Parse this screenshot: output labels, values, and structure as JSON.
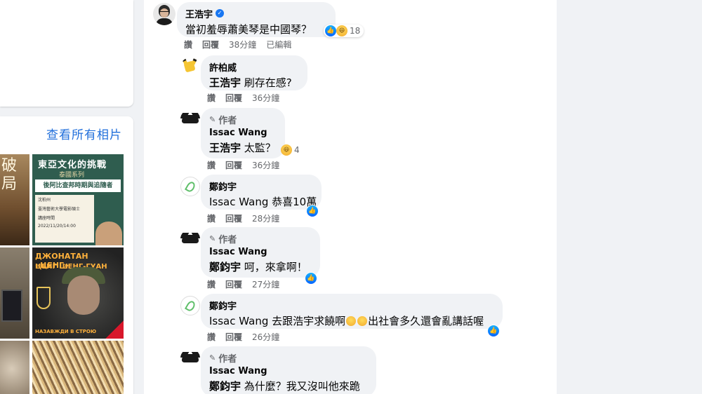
{
  "left_panel": {
    "photos_link": "查看所有相片",
    "thumb1_text": "破\n局",
    "thumb2": {
      "title": "東亞文化的挑戰",
      "subtitle": "泰國系列",
      "band": "後阿比查邦時期與追隨者",
      "lines": [
        "沈柏州",
        "臺灣藝術大學電影碩士",
        "講座時間",
        "2022/11/20/14:00"
      ]
    },
    "thumb4": {
      "line1": "ДЖОНАТАН «ЦЕНГ»",
      "line2": "ЦЕНГ ШЕНГ-ГУАН",
      "bottom": "НАЗАВЖДИ В СТРОЮ"
    }
  },
  "comments": [
    {
      "author": "王浩宇",
      "verified": true,
      "text": "當初羞辱蕭美琴是中國琴？",
      "reactions": [
        "like",
        "haha"
      ],
      "reaction_count": "18",
      "actions": [
        "讚",
        "回覆"
      ],
      "time": "38分鐘",
      "edited": "已編輯"
    },
    {
      "author": "許柏威",
      "mention": "王浩宇",
      "text": "刷存在感?",
      "actions": [
        "讚",
        "回覆"
      ],
      "time": "36分鐘"
    },
    {
      "badge": "作者",
      "author": "Issac Wang",
      "mention": "王浩宇",
      "text": "太監？",
      "reactions": [
        "haha"
      ],
      "reaction_count": "4",
      "actions": [
        "讚",
        "回覆"
      ],
      "time": "36分鐘"
    },
    {
      "author": "鄭鈞宇",
      "mention": "Issac Wang",
      "text": "恭喜10萬",
      "reactions": [
        "like"
      ],
      "actions": [
        "讚",
        "回覆"
      ],
      "time": "28分鐘"
    },
    {
      "badge": "作者",
      "author": "Issac Wang",
      "mention": "鄭鈞宇",
      "text": "呵，來拿啊！",
      "reactions": [
        "like"
      ],
      "actions": [
        "讚",
        "回覆"
      ],
      "time": "27分鐘"
    },
    {
      "author": "鄭鈞宇",
      "mention": "Issac Wang",
      "text_a": "去跟浩宇求饒啊",
      "text_b": "出社會多久還會亂講話喔",
      "reactions": [
        "like"
      ],
      "actions": [
        "讚",
        "回覆"
      ],
      "time": "26分鐘"
    },
    {
      "badge": "作者",
      "author": "Issac Wang",
      "mention": "鄭鈞宇",
      "text": "為什麼？我又沒叫他來跪"
    }
  ],
  "colors": {
    "link": "#216fdb",
    "bubble": "#f0f2f5",
    "like": "#0866ff",
    "haha": "#f7c43a",
    "meta": "#65676b"
  }
}
